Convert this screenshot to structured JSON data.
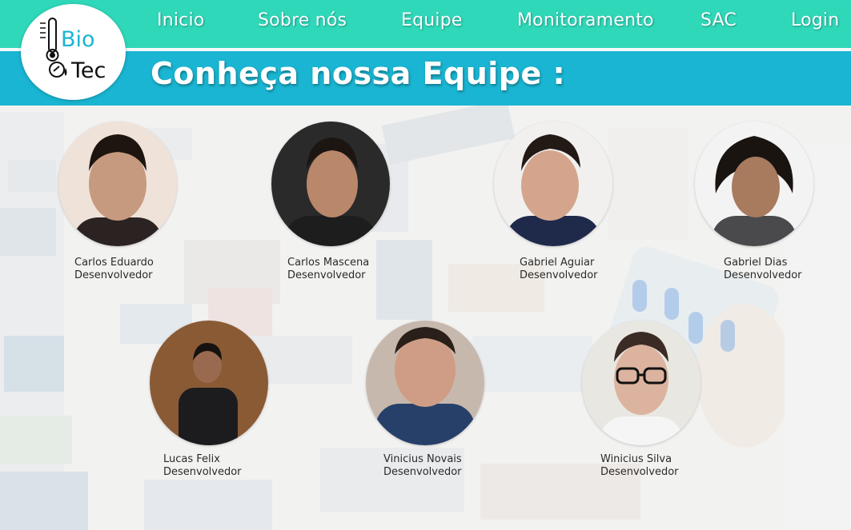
{
  "nav": {
    "items": [
      "Inicio",
      "Sobre nós",
      "Equipe",
      "Monitoramento",
      "SAC",
      "Login"
    ]
  },
  "logo": {
    "text_line1": "Bio",
    "text_line2": "Tec"
  },
  "page": {
    "title": "Conheça nossa Equipe :"
  },
  "team": [
    {
      "name": "Carlos Eduardo",
      "role": "Desenvolvedor",
      "skin": "#c69a7f",
      "hair": "#1e1510",
      "bg": "#efe2d8",
      "shirt": "#2b2322"
    },
    {
      "name": "Carlos Mascena",
      "role": "Desenvolvedor",
      "skin": "#b9876a",
      "hair": "#1c1512",
      "bg": "#2a2a2a",
      "shirt": "#1d1d1d"
    },
    {
      "name": "Gabriel Aguiar",
      "role": "Desenvolvedor",
      "skin": "#d4a58c",
      "hair": "#231a15",
      "bg": "#f1f0ee",
      "shirt": "#1f2a4a"
    },
    {
      "name": "Gabriel Dias",
      "role": "Desenvolvedor",
      "skin": "#a87b5f",
      "hair": "#1a1411",
      "bg": "#f3f3f3",
      "shirt": "#4a4a4c"
    },
    {
      "name": "Lucas Felix",
      "role": "Desenvolvedor",
      "skin": "#9a6a50",
      "hair": "#161210",
      "bg": "#8a5a35",
      "shirt": "#1c1c1e"
    },
    {
      "name": "Vinicius Novais",
      "role": "Desenvolvedor",
      "skin": "#cf9d86",
      "hair": "#2a1f19",
      "bg": "#c7b8ad",
      "shirt": "#27406a"
    },
    {
      "name": "Winicius Silva",
      "role": "Desenvolvedor",
      "skin": "#dcb39e",
      "hair": "#3a2c24",
      "bg": "#e9e7e2",
      "shirt": "#f5f5f5"
    }
  ],
  "colors": {
    "topbar": "#2fd8b9",
    "banner": "#1ab5d2",
    "logo_blue": "#1ab5d2",
    "logo_dark": "#111111"
  }
}
